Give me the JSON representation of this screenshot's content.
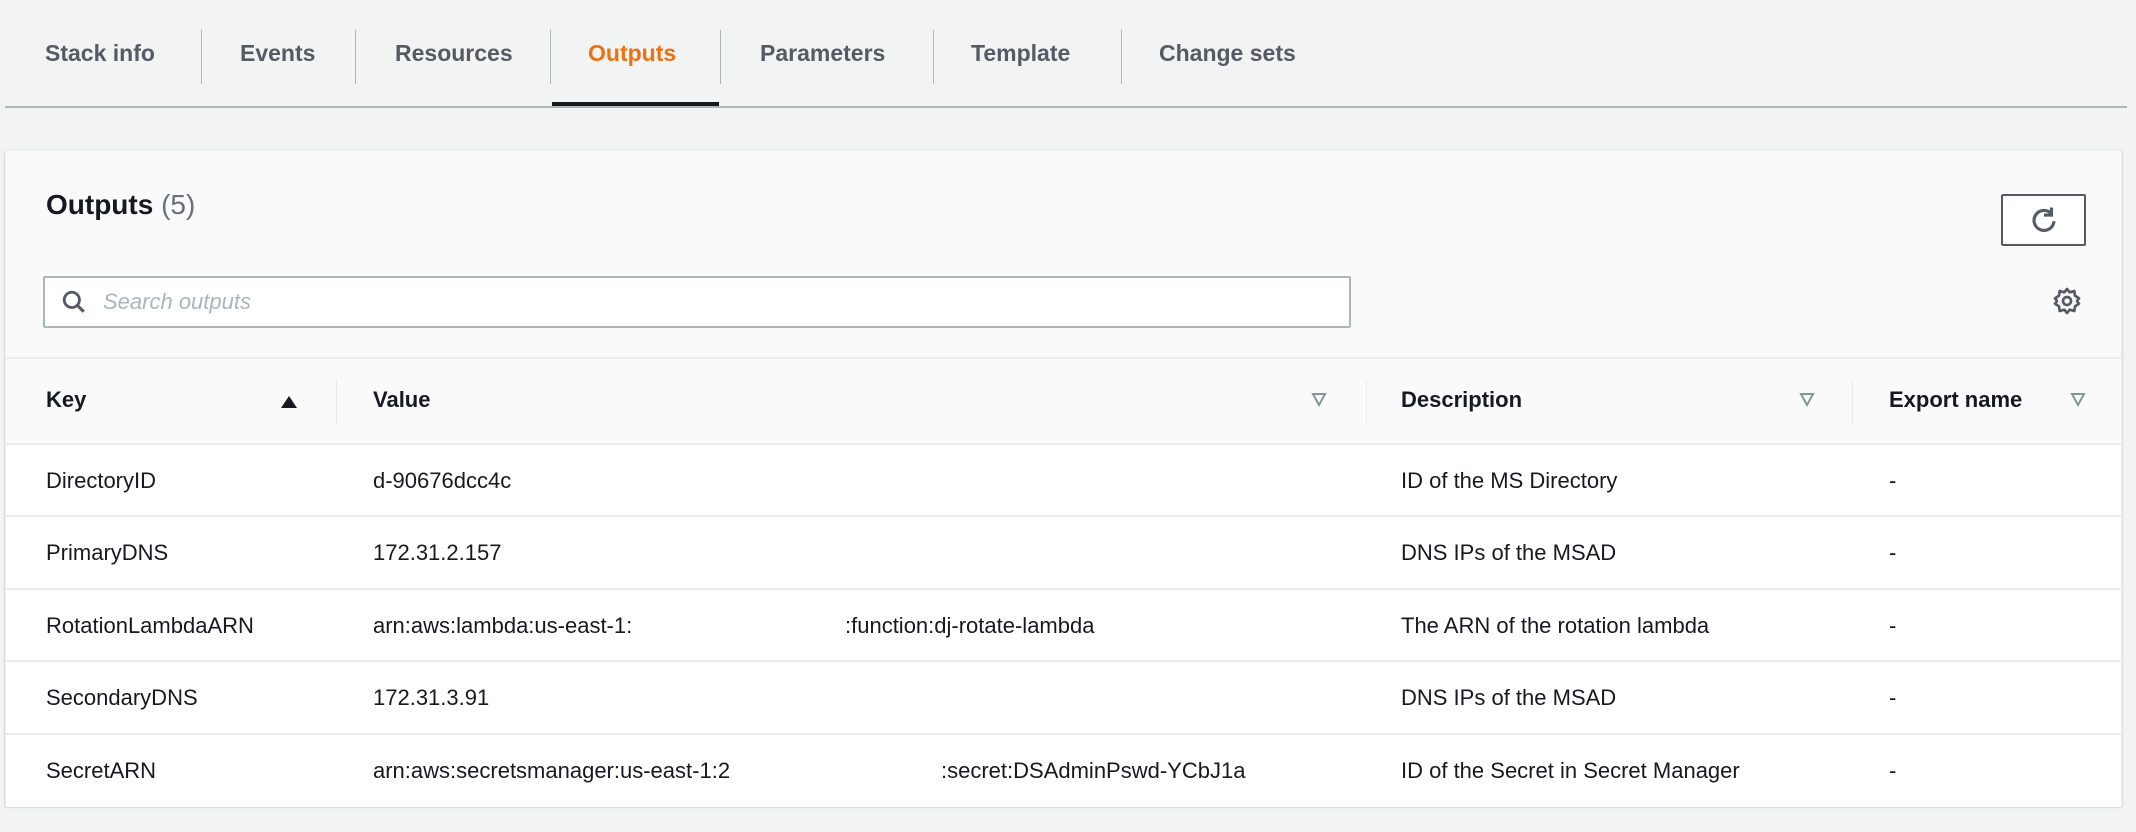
{
  "tabs": [
    {
      "label": "Stack info"
    },
    {
      "label": "Events"
    },
    {
      "label": "Resources"
    },
    {
      "label": "Outputs",
      "active": true
    },
    {
      "label": "Parameters"
    },
    {
      "label": "Template"
    },
    {
      "label": "Change sets"
    }
  ],
  "panel": {
    "title": "Outputs",
    "count": "(5)",
    "search_placeholder": "Search outputs"
  },
  "columns": {
    "key": "Key",
    "value": "Value",
    "description": "Description",
    "export": "Export name"
  },
  "rows": [
    {
      "key": "DirectoryID",
      "value": "d-90676dcc4c",
      "value2": "",
      "description": "ID of the MS Directory",
      "export": "-"
    },
    {
      "key": "PrimaryDNS",
      "value": "172.31.2.157",
      "value2": "",
      "description": "DNS IPs of the MSAD",
      "export": "-"
    },
    {
      "key": "RotationLambdaARN",
      "value": "arn:aws:lambda:us-east-1:",
      "value2": ":function:dj-rotate-lambda",
      "description": "The ARN of the rotation lambda",
      "export": "-"
    },
    {
      "key": "SecondaryDNS",
      "value": "172.31.3.91",
      "value2": "",
      "description": "DNS IPs of the MSAD",
      "export": "-"
    },
    {
      "key": "SecretARN",
      "value": "arn:aws:secretsmanager:us-east-1:2",
      "value2": ":secret:DSAdminPswd-YCbJ1a",
      "description": "ID of the Secret in Secret Manager",
      "export": "-"
    }
  ],
  "colors": {
    "accent": "#ec7211",
    "text": "#16191f",
    "muted": "#545b64"
  }
}
